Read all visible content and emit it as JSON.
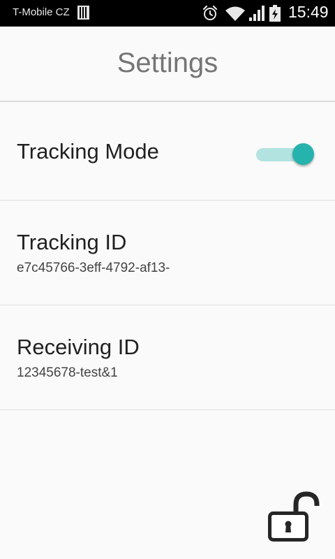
{
  "status_bar": {
    "carrier": "T-Mobile CZ",
    "time": "15:49",
    "icons": [
      "sim-icon",
      "alarm-icon",
      "wifi-icon",
      "signal-icon",
      "battery-charging-icon"
    ]
  },
  "header": {
    "title": "Settings"
  },
  "settings": {
    "tracking_mode": {
      "label": "Tracking Mode",
      "enabled": true
    },
    "tracking_id": {
      "label": "Tracking ID",
      "value": "e7c45766-3eff-4792-af13-"
    },
    "receiving_id": {
      "label": "Receiving ID",
      "value": "12345678-test&1"
    }
  },
  "footer": {
    "lock_icon": "unlocked-padlock-icon"
  },
  "colors": {
    "accent": "#26b3ad",
    "accent_track": "#b2e3e0",
    "status_bar_bg": "#000000",
    "page_bg": "#fafafa"
  }
}
